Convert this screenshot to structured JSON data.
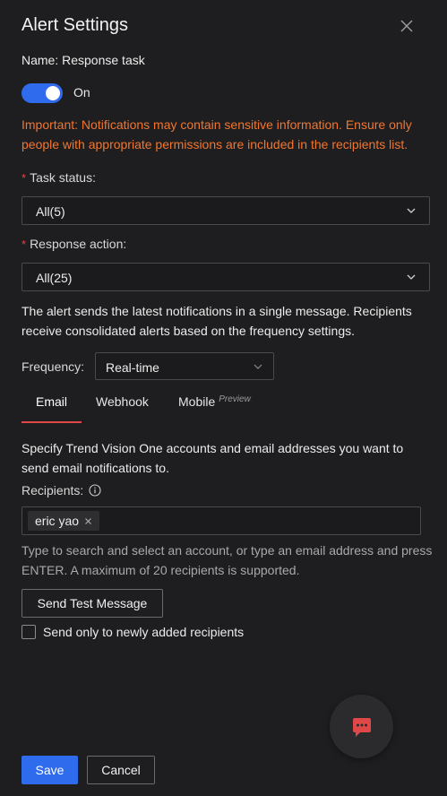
{
  "header": {
    "title": "Alert Settings",
    "close_icon": "close-icon"
  },
  "name_line": "Name: Response task",
  "toggle": {
    "state": "on",
    "label": "On"
  },
  "warning": "Important: Notifications may contain sensitive information. Ensure only people with appropriate permissions are included in the recipients list.",
  "task_status": {
    "required_mark": "*",
    "label": "Task status:",
    "value": "All(5)"
  },
  "response_action": {
    "required_mark": "*",
    "label": "Response action:",
    "value": "All(25)"
  },
  "info_text": "The alert sends the latest notifications in a single message. Recipients receive consolidated alerts based on the frequency settings.",
  "frequency": {
    "label": "Frequency:",
    "value": "Real-time"
  },
  "tabs": [
    {
      "label": "Email",
      "active": true
    },
    {
      "label": "Webhook",
      "active": false
    },
    {
      "label": "Mobile",
      "badge": "Preview",
      "active": false
    }
  ],
  "email": {
    "description": "Specify Trend Vision One accounts and email addresses you want to send email notifications to.",
    "recipients_label": "Recipients:",
    "recipients": [
      "eric yao"
    ],
    "hint": "Type to search and select an account, or type an email address and press ENTER. A maximum of 20 recipients is supported.",
    "send_test_label": "Send Test Message",
    "new_only_label": "Send only to newly added recipients"
  },
  "footer": {
    "save_label": "Save",
    "cancel_label": "Cancel"
  },
  "colors": {
    "accent": "#2f6bed",
    "warning": "#f2762e",
    "required": "#e04848",
    "chat_icon": "#e04848"
  }
}
